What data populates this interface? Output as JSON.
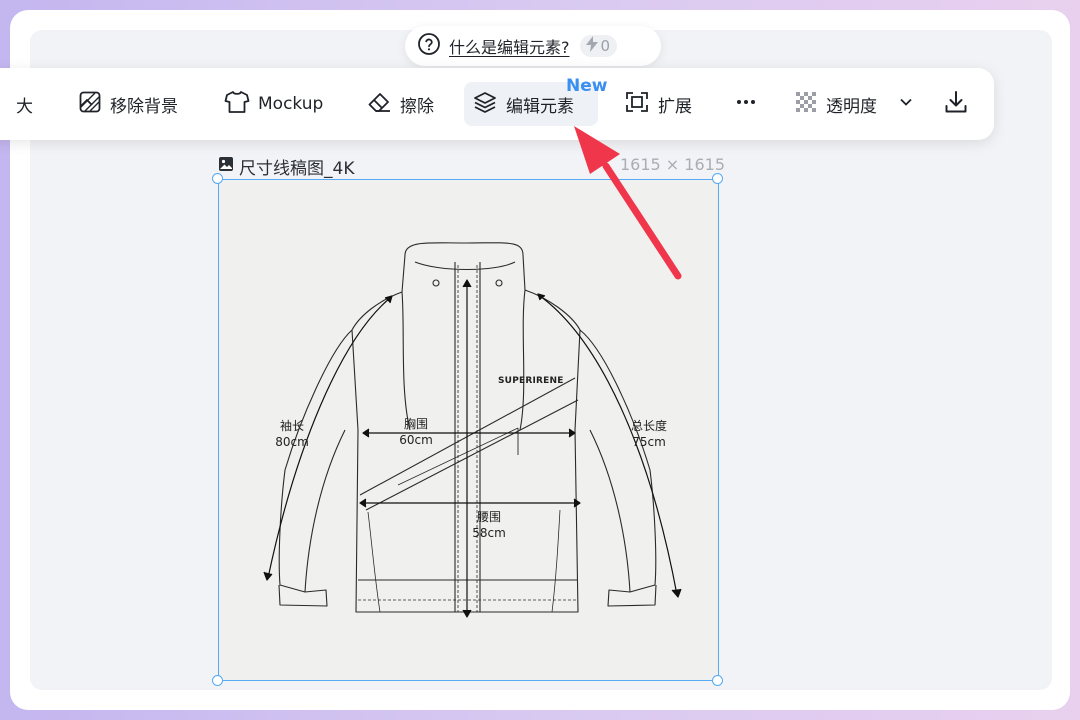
{
  "help": {
    "link_text": "什么是编辑元素?",
    "credits": "0"
  },
  "toolbar": {
    "items": [
      {
        "label": "大",
        "icon": "enlarge-icon"
      },
      {
        "label": "移除背景",
        "icon": "remove-background-icon"
      },
      {
        "label": "Mockup",
        "icon": "tshirt-icon"
      },
      {
        "label": "擦除",
        "icon": "eraser-icon"
      },
      {
        "label": "编辑元素",
        "icon": "layers-edit-icon",
        "badge": "New",
        "active": true
      },
      {
        "label": "扩展",
        "icon": "expand-icon"
      },
      {
        "label": "",
        "icon": "more-icon"
      },
      {
        "label": "透明度",
        "icon": "transparency-icon",
        "dropdown": true
      },
      {
        "label": "",
        "icon": "download-icon"
      }
    ]
  },
  "image": {
    "name": "尺寸线稿图_4K",
    "size": "1615 × 1615",
    "brand": "SUPERIRENE",
    "measures": {
      "sleeve": {
        "label": "袖长",
        "value": "80cm"
      },
      "chest": {
        "label": "胸围",
        "value": "60cm"
      },
      "length": {
        "label": "总长度",
        "value": "75cm"
      },
      "waist": {
        "label": "腰围",
        "value": "58cm"
      }
    }
  },
  "colors": {
    "accent_blue": "#56a9f2",
    "badge_blue": "#3a8ff0",
    "arrow_red": "#f0364a"
  }
}
